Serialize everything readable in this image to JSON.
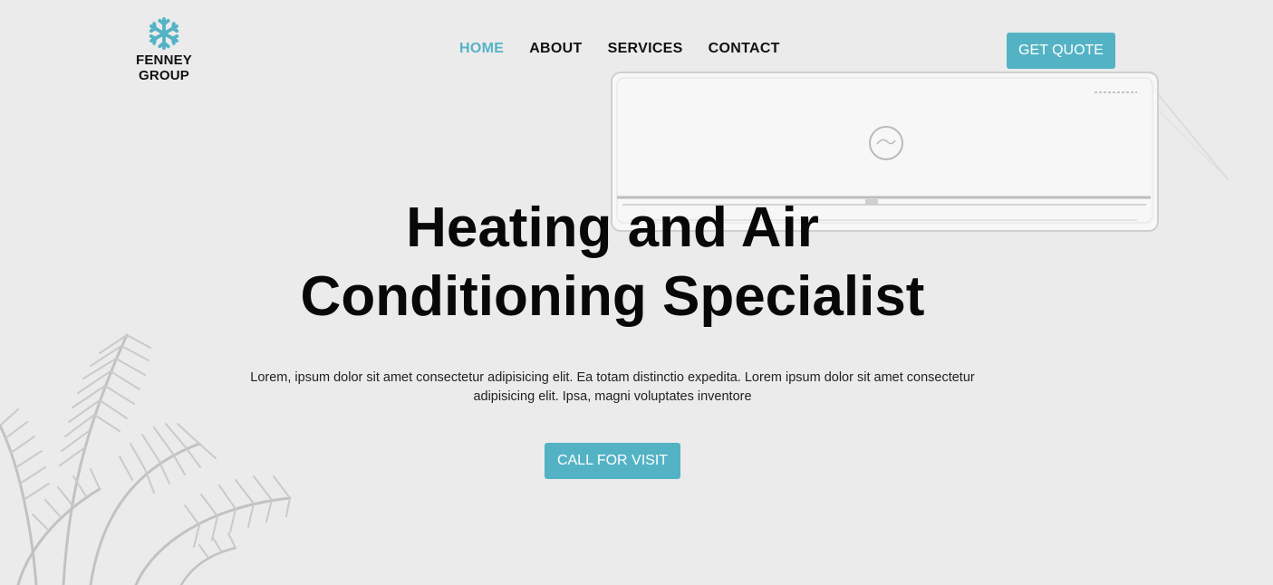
{
  "brand": {
    "name": "FENNEY GROUP",
    "icon": "snowflake-icon"
  },
  "nav": {
    "items": [
      {
        "label": "HOME",
        "active": true
      },
      {
        "label": "ABOUT",
        "active": false
      },
      {
        "label": "SERVICES",
        "active": false
      },
      {
        "label": "CONTACT",
        "active": false
      }
    ]
  },
  "header": {
    "quote_label": "GET QUOTE"
  },
  "hero": {
    "title_line1": "Heating and Air",
    "title_line2": "Conditioning Specialist",
    "description": "Lorem, ipsum dolor sit amet consectetur adipisicing elit. Ea totam distinctio expedita. Lorem ipsum dolor sit amet consectetur adipisicing elit. Ipsa, magni voluptates inventore",
    "cta_label": "CALL FOR VISIT"
  },
  "colors": {
    "accent": "#53b3c5",
    "background": "#ebebeb",
    "text": "#111111"
  }
}
